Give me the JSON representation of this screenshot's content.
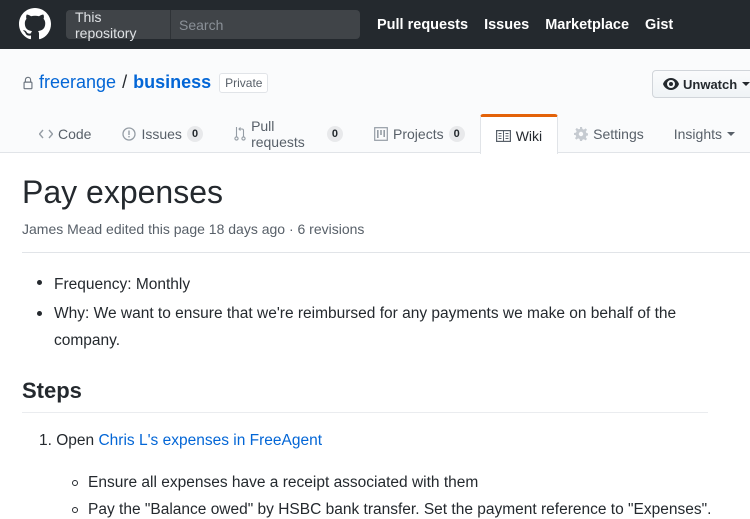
{
  "header": {
    "search_scope": "This repository",
    "search_placeholder": "Search",
    "nav": [
      "Pull requests",
      "Issues",
      "Marketplace",
      "Gist"
    ]
  },
  "repo": {
    "owner": "freerange",
    "separator": "/",
    "name": "business",
    "visibility": "Private",
    "watch_label": "Unwatch"
  },
  "tabs": [
    {
      "label": "Code",
      "icon": "code-icon"
    },
    {
      "label": "Issues",
      "icon": "issue-icon",
      "count": "0"
    },
    {
      "label": "Pull requests",
      "icon": "pull-request-icon",
      "count": "0"
    },
    {
      "label": "Projects",
      "icon": "project-icon",
      "count": "0"
    },
    {
      "label": "Wiki",
      "icon": "book-icon",
      "selected": true
    },
    {
      "label": "Settings",
      "icon": "gear-icon"
    },
    {
      "label": "Insights",
      "icon": "caret-down-icon"
    }
  ],
  "page": {
    "title": "Pay expenses",
    "meta": "James Mead edited this page 18 days ago · 6 revisions",
    "bullets": [
      "Frequency: Monthly",
      "Why: We want to ensure that we're reimbursed for any payments we make on behalf of the company."
    ],
    "steps_heading": "Steps",
    "step1_number": "1.",
    "step1_prefix": "Open",
    "step1_link": "Chris L's expenses in FreeAgent",
    "sub_items": [
      "Ensure all expenses have a receipt associated with them",
      "Pay the \"Balance owed\" by HSBC bank transfer. Set the payment reference to \"Expenses\"."
    ]
  },
  "colors": {
    "header_bg": "#24292e",
    "link": "#0366d6",
    "selected_tab_accent": "#e36209"
  }
}
